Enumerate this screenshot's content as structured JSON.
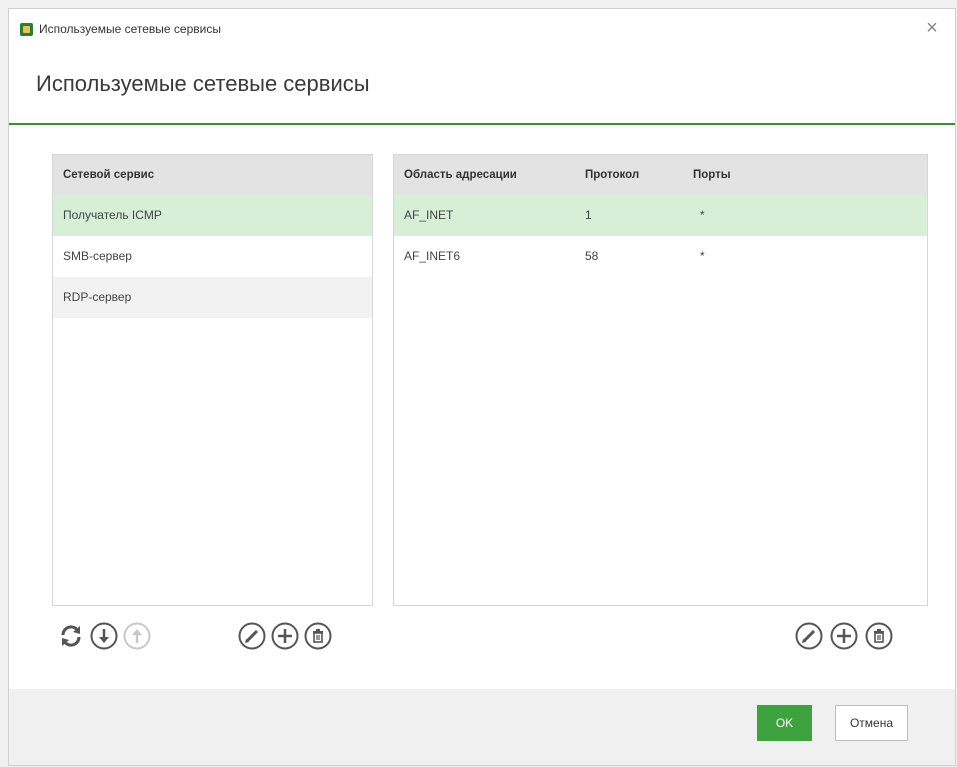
{
  "window": {
    "title": "Используемые сетевые сервисы",
    "heading": "Используемые сетевые сервисы",
    "close_symbol": "×"
  },
  "services": {
    "header": "Сетевой сервис",
    "rows": [
      {
        "name": "Получатель ICMP",
        "state": "selected"
      },
      {
        "name": "SMB-сервер",
        "state": "normal"
      },
      {
        "name": "RDP-сервер",
        "state": "alt"
      }
    ]
  },
  "details": {
    "headers": {
      "area": "Область адресации",
      "protocol": "Протокол",
      "ports": "Порты"
    },
    "rows": [
      {
        "area": "AF_INET",
        "protocol": "1",
        "ports": "*",
        "state": "selected"
      },
      {
        "area": "AF_INET6",
        "protocol": "58",
        "ports": "*",
        "state": "normal"
      }
    ]
  },
  "toolbar_left": [
    "refresh-icon",
    "move-down-icon",
    "move-up-icon",
    "edit-icon",
    "add-icon",
    "delete-icon"
  ],
  "toolbar_right": [
    "edit-icon",
    "add-icon",
    "delete-icon"
  ],
  "buttons": {
    "ok": "OK",
    "cancel": "Отмена"
  },
  "colors": {
    "accent": "#3c8c3c",
    "selected_row": "#d6efd6",
    "ok_button": "#3ea33e",
    "disabled_icon": "#c8c8c8"
  }
}
